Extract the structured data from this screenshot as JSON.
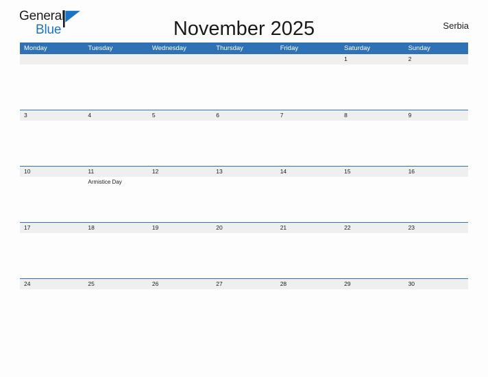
{
  "brand": {
    "name_part1": "General",
    "name_part2": "Blue",
    "flag_icon": "flag-icon",
    "accent_color": "#1a73c4"
  },
  "header": {
    "title": "November 2025",
    "region": "Serbia"
  },
  "theme": {
    "header_bar_color": "#2e71b4",
    "date_band_color": "#efefef",
    "rule_color": "#2e71b4",
    "page_background": "#fdfdfd",
    "text_color": "#1a1a1a"
  },
  "calendar": {
    "month": "November",
    "year": "2025",
    "weekday_headers": [
      "Monday",
      "Tuesday",
      "Wednesday",
      "Thursday",
      "Friday",
      "Saturday",
      "Sunday"
    ],
    "weeks": [
      {
        "days": [
          {
            "date": "",
            "events": []
          },
          {
            "date": "",
            "events": []
          },
          {
            "date": "",
            "events": []
          },
          {
            "date": "",
            "events": []
          },
          {
            "date": "",
            "events": []
          },
          {
            "date": "1",
            "events": []
          },
          {
            "date": "2",
            "events": []
          }
        ]
      },
      {
        "days": [
          {
            "date": "3",
            "events": []
          },
          {
            "date": "4",
            "events": []
          },
          {
            "date": "5",
            "events": []
          },
          {
            "date": "6",
            "events": []
          },
          {
            "date": "7",
            "events": []
          },
          {
            "date": "8",
            "events": []
          },
          {
            "date": "9",
            "events": []
          }
        ]
      },
      {
        "days": [
          {
            "date": "10",
            "events": []
          },
          {
            "date": "11",
            "events": [
              "Armistice Day"
            ]
          },
          {
            "date": "12",
            "events": []
          },
          {
            "date": "13",
            "events": []
          },
          {
            "date": "14",
            "events": []
          },
          {
            "date": "15",
            "events": []
          },
          {
            "date": "16",
            "events": []
          }
        ]
      },
      {
        "days": [
          {
            "date": "17",
            "events": []
          },
          {
            "date": "18",
            "events": []
          },
          {
            "date": "19",
            "events": []
          },
          {
            "date": "20",
            "events": []
          },
          {
            "date": "21",
            "events": []
          },
          {
            "date": "22",
            "events": []
          },
          {
            "date": "23",
            "events": []
          }
        ]
      },
      {
        "days": [
          {
            "date": "24",
            "events": []
          },
          {
            "date": "25",
            "events": []
          },
          {
            "date": "26",
            "events": []
          },
          {
            "date": "27",
            "events": []
          },
          {
            "date": "28",
            "events": []
          },
          {
            "date": "29",
            "events": []
          },
          {
            "date": "30",
            "events": []
          }
        ]
      }
    ]
  }
}
